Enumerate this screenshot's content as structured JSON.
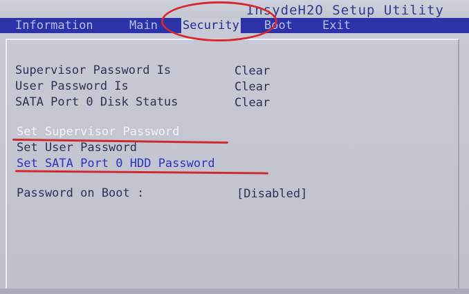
{
  "title": "InsydeH2O Setup Utility",
  "menu": {
    "information": "Information",
    "main": "Main",
    "security": "Security",
    "boot": "Boot",
    "exit": "Exit"
  },
  "status": {
    "supervisor_label": "Supervisor Password Is",
    "supervisor_value": "Clear",
    "user_label": "User Password Is",
    "user_value": "Clear",
    "sata_label": "SATA Port 0 Disk Status",
    "sata_value": "Clear"
  },
  "options": {
    "set_supervisor": "Set Supervisor Password",
    "set_user": "Set User Password",
    "set_sata": "Set SATA Port 0 HDD Password"
  },
  "boot_password": {
    "label": "Password on Boot :",
    "value": "[Disabled]"
  }
}
